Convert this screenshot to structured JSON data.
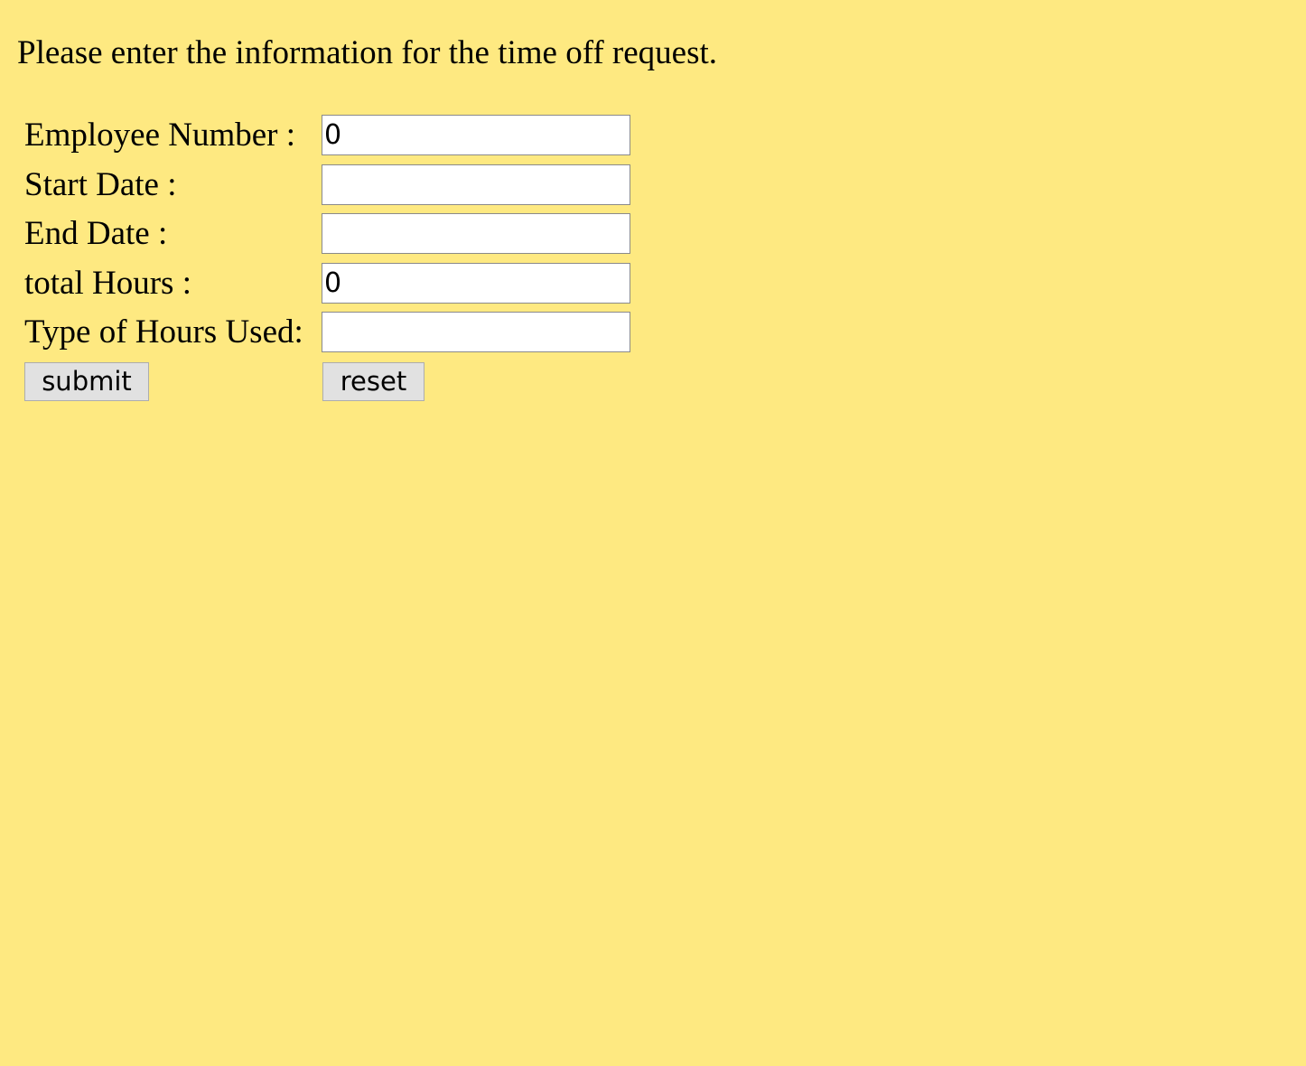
{
  "page": {
    "background_color": "#FEE981",
    "intro_text": "Please enter the information for the time off request."
  },
  "form": {
    "fields": [
      {
        "label": "Employee Number :",
        "value": "0",
        "placeholder": ""
      },
      {
        "label": "Start Date :",
        "value": "",
        "placeholder": ""
      },
      {
        "label": "End Date :",
        "value": "",
        "placeholder": ""
      },
      {
        "label": "total Hours :",
        "value": "0",
        "placeholder": ""
      },
      {
        "label": "Type of Hours Used:",
        "value": "",
        "placeholder": ""
      }
    ],
    "submit_label": "submit",
    "reset_label": "reset"
  }
}
